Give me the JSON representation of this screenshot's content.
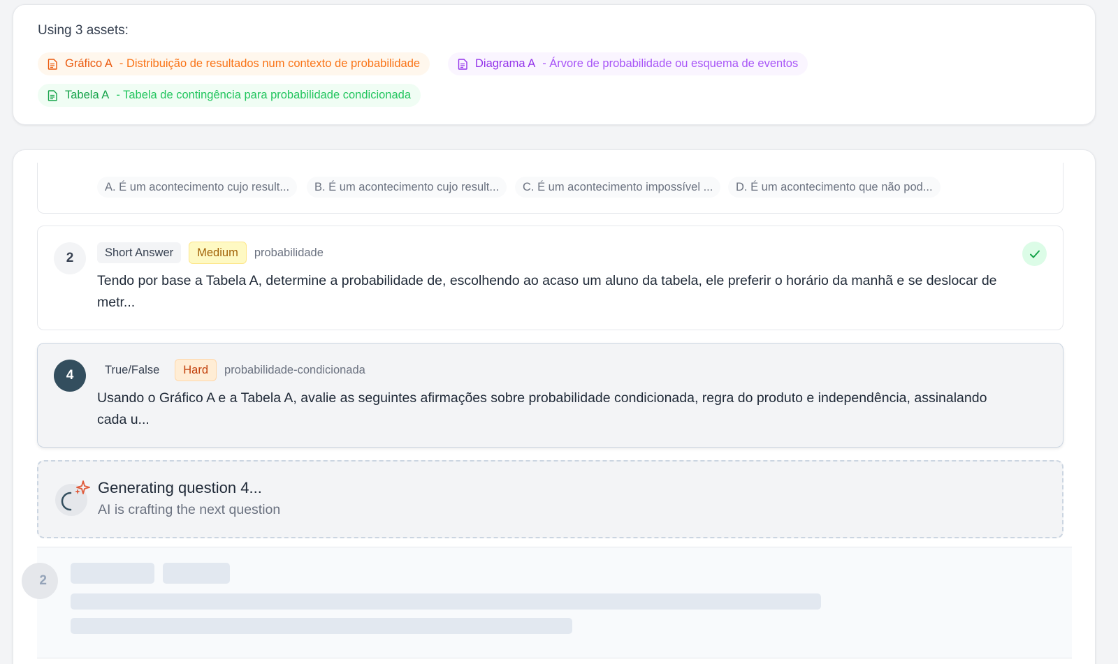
{
  "assets": {
    "title": "Using 3 assets:",
    "items": [
      {
        "name": "Gráfico A",
        "desc": "- Distribuição de resultados num contexto de probabilidade",
        "color": "#ea580c"
      },
      {
        "name": "Diagrama A",
        "desc": "- Árvore de probabilidade ou esquema de eventos",
        "color": "#9333ea"
      },
      {
        "name": "Tabela A",
        "desc": "- Tabela de contingência para probabilidade condicionada",
        "color": "#16a34a"
      }
    ]
  },
  "partial_question": {
    "options": [
      "A. É um acontecimento cujo result...",
      "B. É um acontecimento cujo result...",
      "C. É um acontecimento impossível ...",
      "D. É um acontecimento que não pod..."
    ]
  },
  "questions": [
    {
      "number": "2",
      "type": "Short Answer",
      "difficulty": "Medium",
      "topic": "probabilidade",
      "text": "Tendo por base a Tabela A, determine a probabilidade de, escolhendo ao acaso um aluno da tabela, ele preferir o horário da manhã e se deslocar de metr...",
      "status_icon": "check-icon"
    },
    {
      "number": "4",
      "type": "True/False",
      "difficulty": "Hard",
      "topic": "probabilidade-condicionada",
      "text": "Usando o Gráfico A e a Tabela A, avalie as seguintes afirmações sobre probabilidade condicionada, regra do produto e independência, assinalando cada u..."
    }
  ],
  "generating": {
    "title": "Generating question 4...",
    "subtitle": "AI is crafting the next question",
    "icon": "sparkle-spinner-icon"
  },
  "skeleton": {
    "number": "2"
  },
  "colors": {
    "active_number_bg": "#334e5e",
    "check_green": "#16a34a",
    "sparkle": "#e05a3a"
  }
}
